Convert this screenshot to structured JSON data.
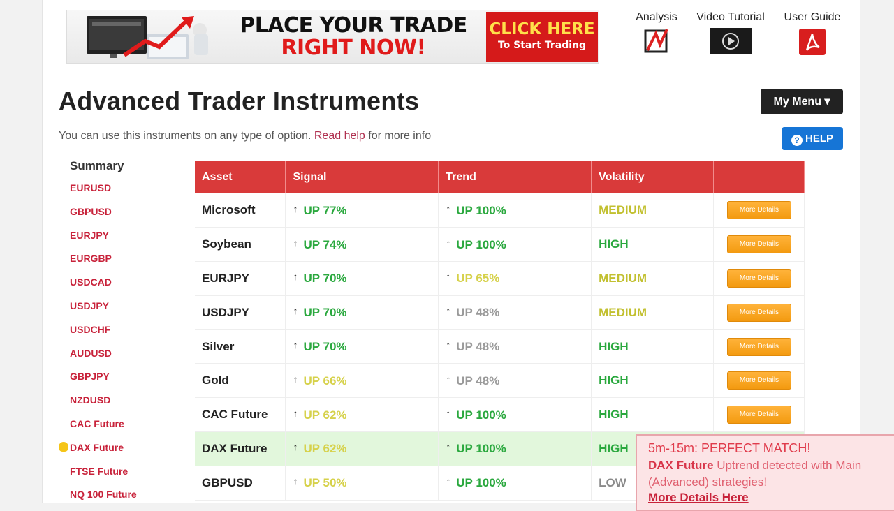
{
  "banner": {
    "line1": "PLACE YOUR TRADE",
    "line2": "RIGHT NOW!",
    "cta_main": "CLICK HERE",
    "cta_sub": "To Start Trading"
  },
  "toplinks": [
    {
      "label": "Analysis",
      "icon": "analysis-icon"
    },
    {
      "label": "Video Tutorial",
      "icon": "video-play-icon"
    },
    {
      "label": "User Guide",
      "icon": "pdf-icon"
    }
  ],
  "page": {
    "title": "Advanced Trader Instruments",
    "subtitle_pre": "You can use this instruments on any type of option.",
    "subtitle_link": "Read help",
    "subtitle_post": "for more info",
    "menu_label": "My Menu ▾",
    "help_label": "HELP"
  },
  "sidebar": {
    "heading": "Summary",
    "items": [
      "EURUSD",
      "GBPUSD",
      "EURJPY",
      "EURGBP",
      "USDCAD",
      "USDJPY",
      "USDCHF",
      "AUDUSD",
      "GBPJPY",
      "NZDUSD",
      "CAC Future",
      "DAX Future",
      "FTSE Future",
      "NQ 100 Future"
    ],
    "highlighted": "DAX Future"
  },
  "table": {
    "headers": [
      "Asset",
      "Signal",
      "Trend",
      "Volatility",
      ""
    ],
    "button_label": "More Details",
    "rows": [
      {
        "asset": "Microsoft",
        "signal": "UP 77%",
        "signal_color": "#2aa83e",
        "trend": "UP 100%",
        "trend_color": "#2aa83e",
        "volatility": "MEDIUM",
        "vol_color": "#c2c030"
      },
      {
        "asset": "Soybean",
        "signal": "UP 74%",
        "signal_color": "#2aa83e",
        "trend": "UP 100%",
        "trend_color": "#2aa83e",
        "volatility": "HIGH",
        "vol_color": "#2aa83e"
      },
      {
        "asset": "EURJPY",
        "signal": "UP 70%",
        "signal_color": "#2aa83e",
        "trend": "UP 65%",
        "trend_color": "#d6d14a",
        "volatility": "MEDIUM",
        "vol_color": "#c2c030"
      },
      {
        "asset": "USDJPY",
        "signal": "UP 70%",
        "signal_color": "#2aa83e",
        "trend": "UP 48%",
        "trend_color": "#9a9a9a",
        "volatility": "MEDIUM",
        "vol_color": "#c2c030"
      },
      {
        "asset": "Silver",
        "signal": "UP 70%",
        "signal_color": "#2aa83e",
        "trend": "UP 48%",
        "trend_color": "#9a9a9a",
        "volatility": "HIGH",
        "vol_color": "#2aa83e"
      },
      {
        "asset": "Gold",
        "signal": "UP 66%",
        "signal_color": "#d6d14a",
        "trend": "UP 48%",
        "trend_color": "#9a9a9a",
        "volatility": "HIGH",
        "vol_color": "#2aa83e"
      },
      {
        "asset": "CAC Future",
        "signal": "UP 62%",
        "signal_color": "#d6d14a",
        "trend": "UP 100%",
        "trend_color": "#2aa83e",
        "volatility": "HIGH",
        "vol_color": "#2aa83e"
      },
      {
        "asset": "DAX Future",
        "signal": "UP 62%",
        "signal_color": "#d6d14a",
        "trend": "UP 100%",
        "trend_color": "#2aa83e",
        "volatility": "HIGH",
        "vol_color": "#2aa83e",
        "highlight": true
      },
      {
        "asset": "GBPUSD",
        "signal": "UP 50%",
        "signal_color": "#d6d14a",
        "trend": "UP 100%",
        "trend_color": "#2aa83e",
        "volatility": "LOW",
        "vol_color": "#8a8a8a"
      }
    ]
  },
  "popup": {
    "title": "5m-15m: PERFECT MATCH!",
    "asset": "DAX Future",
    "message": "Uptrend detected with Main (Advanced) strategies!",
    "link": "More Details Here"
  }
}
